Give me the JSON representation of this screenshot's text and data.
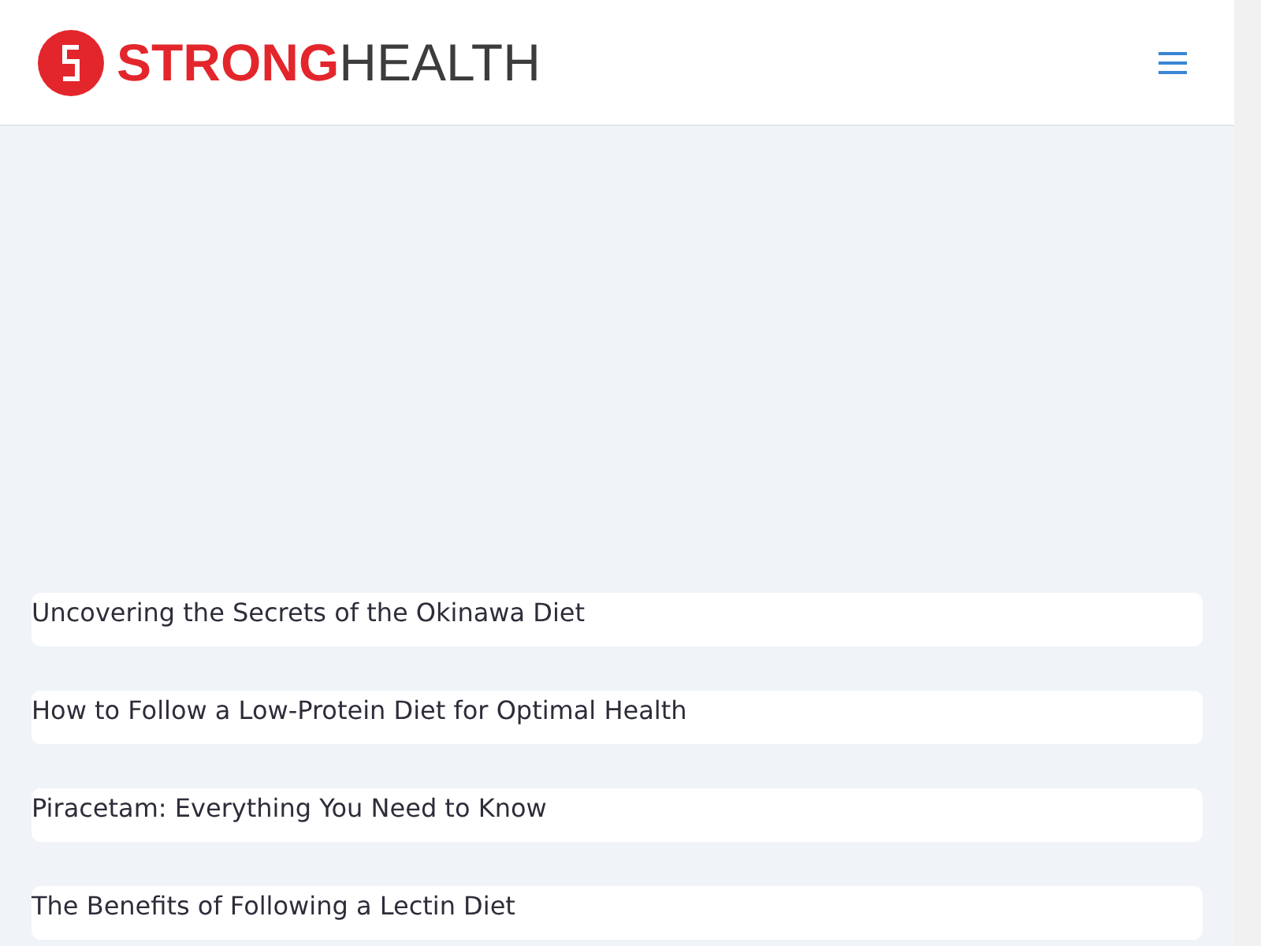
{
  "header": {
    "logo": {
      "strong": "STRONG",
      "health": "HEALTH"
    }
  },
  "posts": [
    {
      "title": "Uncovering the Secrets of the Okinawa Diet"
    },
    {
      "title": "How to Follow a Low-Protein Diet for Optimal Health"
    },
    {
      "title": "Piracetam: Everything You Need to Know"
    },
    {
      "title": "The Benefits of Following a Lectin Diet"
    }
  ]
}
